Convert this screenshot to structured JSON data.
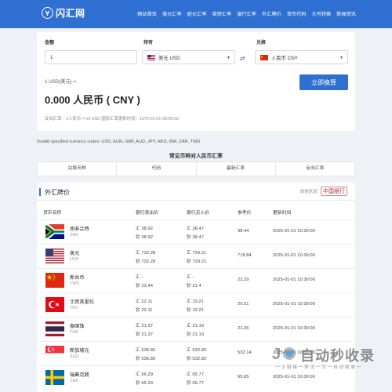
{
  "header": {
    "logo_text": "闪汇网",
    "nav": [
      "网站首页",
      "美元汇率",
      "欧元汇率",
      "英镑汇率",
      "银行汇率",
      "外汇牌价",
      "货币代码",
      "大写转换",
      "新闻资讯"
    ]
  },
  "converter": {
    "amount_label": "金额",
    "amount_value": "1",
    "have_label": "持有",
    "have_value": "美元 USD",
    "want_label": "兑换",
    "want_value": "人民币 CNY",
    "line1": "1 USD(美元) =",
    "result": "0.000 人民币 ( CNY )",
    "note": "反向汇率：1人民币 = inf USD  国际汇率更新时间：1970-01-01 08:00:00",
    "button_label": "立即换算"
  },
  "invalid_text": "Invalid specified currency codes: USD, EUR, GBP, AUD, JPY, HKD, INR, ZAR, TWD",
  "common": {
    "title": "常见币种对人民币汇率",
    "headers": [
      "兑换币种",
      "代码",
      "最新汇率",
      "反向汇率"
    ]
  },
  "forex": {
    "title": "外汇牌价",
    "source_label": "数据来源:",
    "source_logo": "中国银行",
    "headers": [
      "货币名称",
      "银行卖出价",
      "银行买入价",
      "参考价",
      "更新时间"
    ],
    "rows": [
      {
        "name": "南非兰特",
        "code": "ZAR",
        "flag": "za",
        "sell_hui": "汇 38.92",
        "sell_chao": "钞 38.92",
        "buy_hui": "汇 38.47",
        "buy_chao": "钞 38.47",
        "ref": "38.44",
        "time": "2025-01-01 10:30:00"
      },
      {
        "name": "美元",
        "code": "USD",
        "flag": "us",
        "sell_hui": "汇 732.28",
        "sell_chao": "钞 732.28",
        "buy_hui": "汇 729.21",
        "buy_chao": "钞 729.21",
        "ref": "718.84",
        "time": "2025-01-01 10:30:00"
      },
      {
        "name": "新台币",
        "code": "TWD",
        "flag": "tw",
        "sell_hui": "汇 -",
        "sell_chao": "钞 23.44",
        "buy_hui": "汇 -",
        "buy_chao": "钞 21.4",
        "ref": "22.29",
        "time": "2025-01-01 10:30:00"
      },
      {
        "name": "土耳其里拉",
        "code": "TRY",
        "flag": "tr",
        "sell_hui": "汇 22.11",
        "sell_chao": "钞 22.11",
        "buy_hui": "汇 19.21",
        "buy_chao": "钞 19.21",
        "ref": "20.51",
        "time": "2025-01-01 10:30:00"
      },
      {
        "name": "泰国铢",
        "code": "THB",
        "flag": "th",
        "sell_hui": "汇 21.37",
        "sell_chao": "钞 21.37",
        "buy_hui": "汇 21.19",
        "buy_chao": "钞 21.19",
        "ref": "21.26",
        "time": "2025-01-01 10:30:00"
      },
      {
        "name": "新加坡元",
        "code": "SGD",
        "flag": "sg",
        "sell_hui": "汇 536.83",
        "sell_chao": "钞 536.83",
        "buy_hui": "汇 532.82",
        "buy_chao": "钞 532.82",
        "ref": "532.14",
        "time": "2025-01-01 10:30:00"
      },
      {
        "name": "瑞典克朗",
        "code": "SEK",
        "flag": "se",
        "sell_hui": "汇 66.29",
        "sell_chao": "钞 66.29",
        "buy_hui": "汇 65.77",
        "buy_chao": "钞 65.77",
        "ref": "65.65",
        "time": "2025-01-01 10:30:00"
      }
    ]
  },
  "watermark": {
    "text": "自动秒收录",
    "sub": "一 上 链 接 一 来 访 一 次 一 自 动 收 录 一"
  }
}
